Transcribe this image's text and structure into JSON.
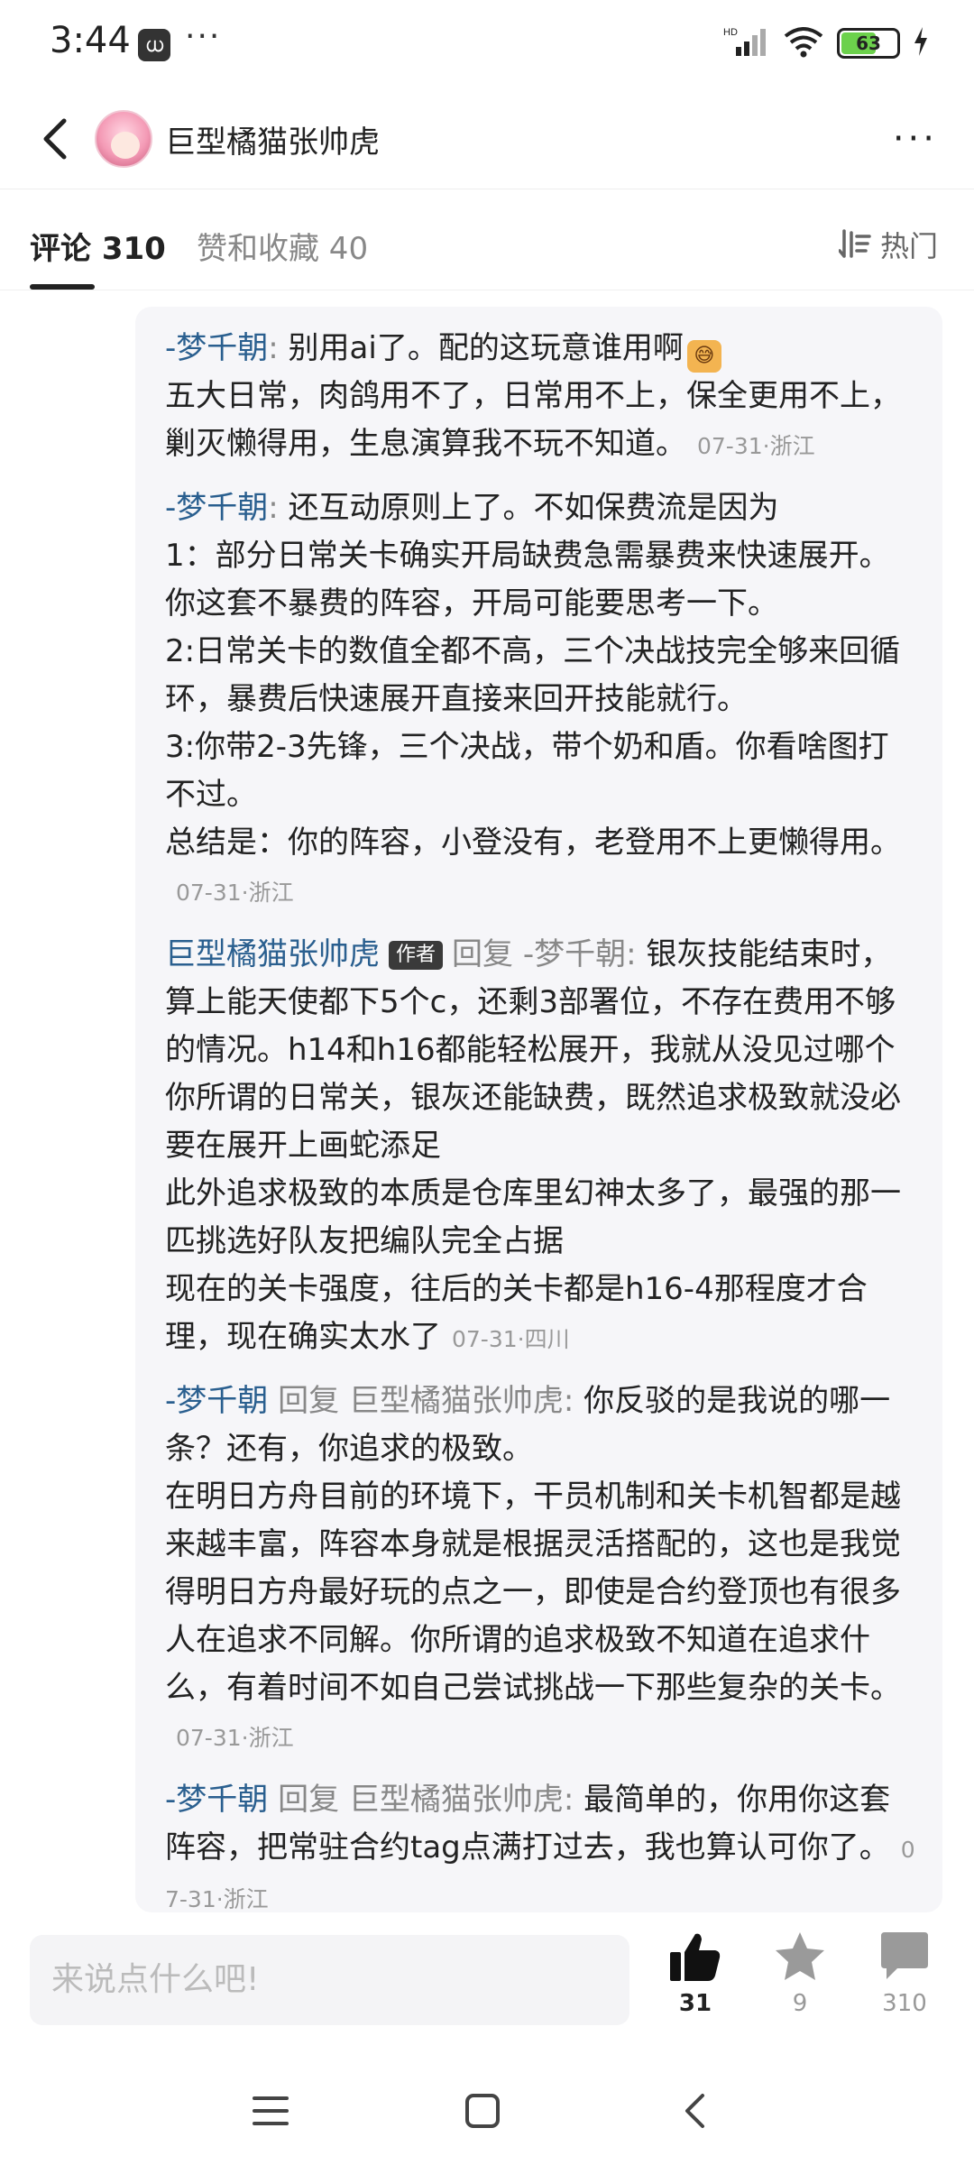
{
  "status_bar": {
    "time": "3:44",
    "app_icon": "ധ",
    "more": "···",
    "network": "HD",
    "battery_level": 63,
    "battery_text": "63"
  },
  "header": {
    "title": "巨型橘猫张帅虎",
    "more": "···"
  },
  "tabs": {
    "comments": "评论 310",
    "likes_favorites": "赞和收藏 40",
    "sort": "热门"
  },
  "replies": [
    {
      "author": "-梦千朝",
      "colon": ":",
      "text": " 别用ai了。配的这玩意谁用啊",
      "emoji_label": "😅",
      "text2": "五大日常，肉鸽用不了，日常用不上，保全更用不上，剿灭懒得用，生息演算我不玩不知道。",
      "meta": "07-31·浙江"
    },
    {
      "author": "-梦千朝",
      "colon": ":",
      "text": " 还互动原则上了。不如保费流是因为",
      "text2": "1：部分日常关卡确实开局缺费急需暴费来快速展开。你这套不暴费的阵容，开局可能要思考一下。",
      "text3": "2:日常关卡的数值全都不高，三个决战技完全够来回循环，暴费后快速展开直接来回开技能就行。",
      "text4": "3:你带2-3先锋，三个决战，带个奶和盾。你看啥图打不过。",
      "text5": "总结是：你的阵容，小登没有，老登用不上更懒得用。",
      "meta": "07-31·浙江"
    },
    {
      "author": "巨型橘猫张帅虎",
      "tag": "作者",
      "reply_word": "回复",
      "target": "-梦千朝",
      "colon": ":",
      "text": " 银灰技能结束时，算上能天使都下5个c，还剩3部署位，不存在费用不够的情况。h14和h16都能轻松展开，我就从没见过哪个你所谓的日常关，银灰还能缺费，既然追求极致就没必要在展开上画蛇添足",
      "text2": "此外追求极致的本质是仓库里幻神太多了，最强的那一匹挑选好队友把编队完全占据",
      "text3": "现在的关卡强度，往后的关卡都是h16-4那程度才合理，现在确实太水了",
      "meta": "07-31·四川"
    },
    {
      "author": "-梦千朝",
      "reply_word": "回复",
      "target": "巨型橘猫张帅虎",
      "colon": ":",
      "text": " 你反驳的是我说的哪一条？还有，你追求的极致。",
      "text2": "在明日方舟目前的环境下，干员机制和关卡机智都是越来越丰富，阵容本身就是根据灵活搭配的，这也是我觉得明日方舟最好玩的点之一，即使是合约登顶也有很多人在追求不同解。你所谓的追求极致不知道在追求什么，有着时间不如自己尝试挑战一下那些复杂的关卡。",
      "meta": "07-31·浙江"
    },
    {
      "author": "-梦千朝",
      "reply_word": "回复",
      "target": "巨型橘猫张帅虎",
      "colon": ":",
      "text": " 最简单的，你用你这套阵容，把常驻合约tag点满打过去，我也算认可你了。",
      "meta": "07-31·浙江"
    }
  ],
  "bottom_bar": {
    "input_placeholder": "来说点什么吧!",
    "like_count": "31",
    "favorite_count": "9",
    "comment_count": "310"
  }
}
